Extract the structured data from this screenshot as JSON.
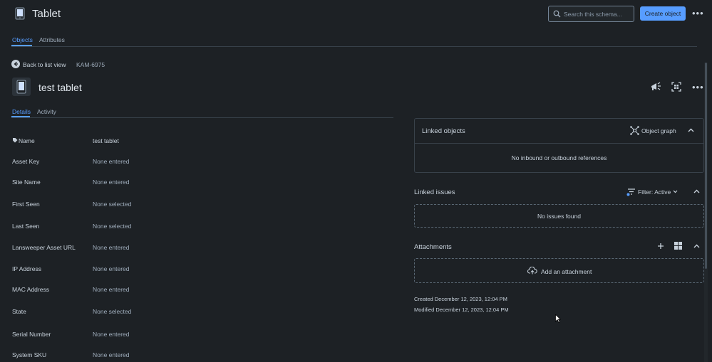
{
  "header": {
    "title": "Tablet",
    "search_placeholder": "Search this schema...",
    "create_label": "Create object",
    "more_label": "•••"
  },
  "tabs": [
    {
      "label": "Objects",
      "active": true
    },
    {
      "label": "Attributes",
      "active": false
    }
  ],
  "object": {
    "back_label": "Back to list view",
    "key": "KAM-6975",
    "name": "test tablet",
    "more_label": "•••"
  },
  "detail_tabs": [
    {
      "label": "Details",
      "active": true
    },
    {
      "label": "Activity",
      "active": false
    }
  ],
  "attributes": [
    {
      "label": "Name",
      "value": "test tablet"
    },
    {
      "label": "Asset Key",
      "value": "None entered"
    },
    {
      "label": "Site Name",
      "value": "None entered"
    },
    {
      "label": "First Seen",
      "value": "None selected"
    },
    {
      "label": "Last Seen",
      "value": "None selected"
    },
    {
      "label": "Lansweeper Asset URL",
      "value": "None entered"
    },
    {
      "label": "IP Address",
      "value": "None entered"
    },
    {
      "label": "MAC Address",
      "value": "None entered"
    },
    {
      "label": "State",
      "value": "None selected"
    },
    {
      "label": "Serial Number",
      "value": "None entered"
    },
    {
      "label": "System SKU",
      "value": "None entered"
    }
  ],
  "linked_objects": {
    "title": "Linked objects",
    "graph_label": "Object graph",
    "empty_text": "No inbound or outbound references"
  },
  "linked_issues": {
    "title": "Linked issues",
    "filter_label": "Filter: Active",
    "empty_text": "No issues found"
  },
  "attachments": {
    "title": "Attachments",
    "add_label": "Add an attachment"
  },
  "meta": {
    "created": "Created December 12, 2023, 12:04 PM",
    "modified": "Modified December 12, 2023, 12:04 PM"
  },
  "colors": {
    "background": "#1d2125",
    "accent": "#579dff",
    "text": "#c7d1db",
    "border": "#38414a"
  }
}
